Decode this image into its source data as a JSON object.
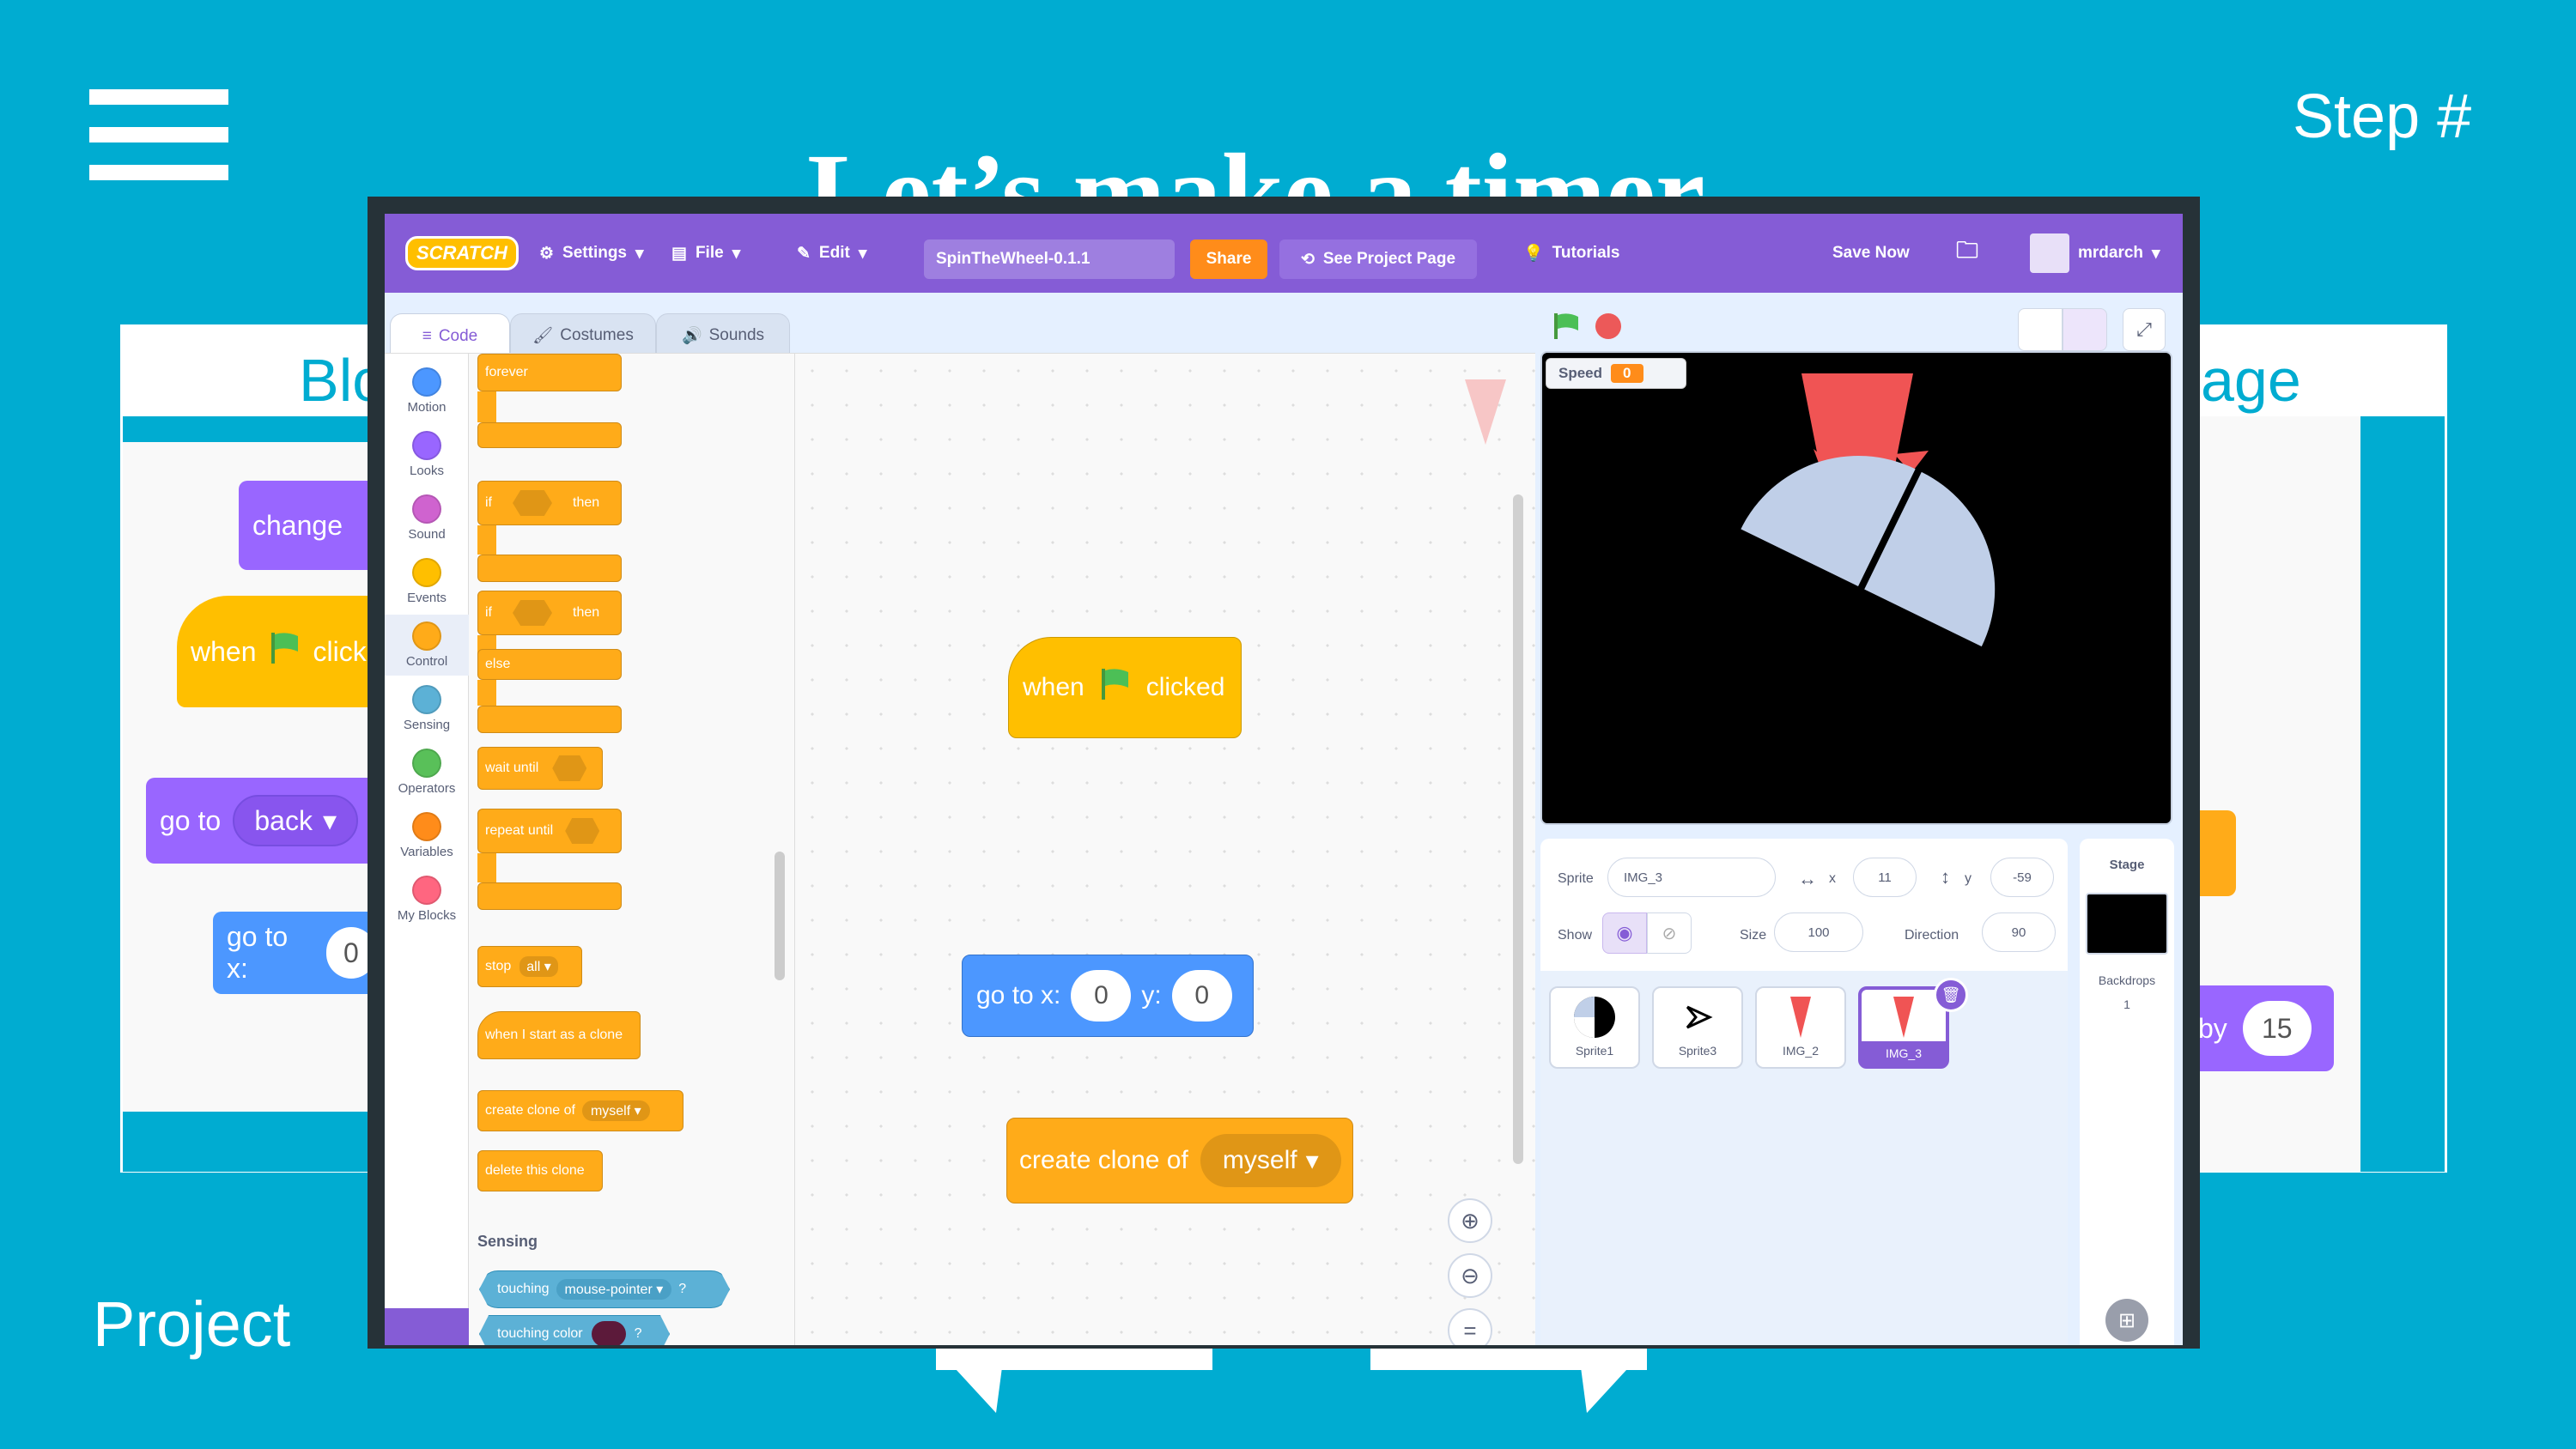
{
  "slide": {
    "step_label": "Step #",
    "title": "Let’s make a timer",
    "footer_label": "Project",
    "left_panel_title": "Blo",
    "right_panel_title": "age"
  },
  "left_panel_blocks": {
    "change": "change",
    "when": "when",
    "clicked_partial": "click",
    "go_to": "go to",
    "back": "back",
    "go_to_x": "go to x:",
    "go_to_x_value": "0"
  },
  "right_panel_blocks": {
    "by": "by",
    "by_value": "15"
  },
  "menubar": {
    "logo": "SCRATCH",
    "settings": "Settings",
    "file": "File",
    "edit": "Edit",
    "project_name": "SpinTheWheel-0.1.1",
    "share": "Share",
    "see_project_page": "See Project Page",
    "tutorials": "Tutorials",
    "save_now": "Save Now",
    "username": "mrdarch"
  },
  "tabs": {
    "code": "Code",
    "costumes": "Costumes",
    "sounds": "Sounds"
  },
  "categories": [
    {
      "label": "Motion",
      "color": "#4c97ff"
    },
    {
      "label": "Looks",
      "color": "#9966ff"
    },
    {
      "label": "Sound",
      "color": "#cf63cf"
    },
    {
      "label": "Events",
      "color": "#ffbf00"
    },
    {
      "label": "Control",
      "color": "#ffab19"
    },
    {
      "label": "Sensing",
      "color": "#5cb1d6"
    },
    {
      "label": "Operators",
      "color": "#59c059"
    },
    {
      "label": "Variables",
      "color": "#ff8c1a"
    },
    {
      "label": "My Blocks",
      "color": "#ff6680"
    }
  ],
  "palette": {
    "forever": "forever",
    "if": "if",
    "then": "then",
    "if2": "if",
    "then2": "then",
    "else": "else",
    "wait_until": "wait until",
    "repeat_until": "repeat until",
    "stop": "stop",
    "stop_option": "all",
    "when_clone": "when I start as a clone",
    "create_clone": "create clone of",
    "create_clone_option": "myself",
    "delete_clone": "delete this clone",
    "sensing_heading": "Sensing",
    "touching": "touching",
    "touching_option": "mouse-pointer",
    "touching_q": "?",
    "touching_color": "touching color",
    "touching_color_q": "?"
  },
  "scripts": {
    "when": "when",
    "clicked": "clicked",
    "goto_label": "go to x:",
    "goto_x": "0",
    "goto_y_label": "y:",
    "goto_y": "0",
    "create_clone": "create clone of",
    "create_clone_option": "myself"
  },
  "stage": {
    "monitor_label": "Speed",
    "monitor_value": "0"
  },
  "sprite_info": {
    "sprite_label": "Sprite",
    "sprite_name": "IMG_3",
    "x_label": "x",
    "x_value": "11",
    "y_label": "y",
    "y_value": "-59",
    "show_label": "Show",
    "size_label": "Size",
    "size_value": "100",
    "direction_label": "Direction",
    "direction_value": "90"
  },
  "sprites": [
    {
      "name": "Sprite1"
    },
    {
      "name": "Sprite3"
    },
    {
      "name": "IMG_2"
    },
    {
      "name": "IMG_3"
    }
  ],
  "stage_panel": {
    "title": "Stage",
    "backdrops_label": "Backdrops",
    "backdrops_count": "1"
  },
  "colors": {
    "background": "#00acd1",
    "scratch_purple": "#855cd6",
    "events_yellow": "#ffbf00",
    "control_orange": "#ffab19",
    "motion_blue": "#4c97ff",
    "looks_purple": "#9966ff",
    "stage_black": "#000000",
    "wheel_color": "#c0cfe8",
    "pointer_red": "#f05454"
  }
}
